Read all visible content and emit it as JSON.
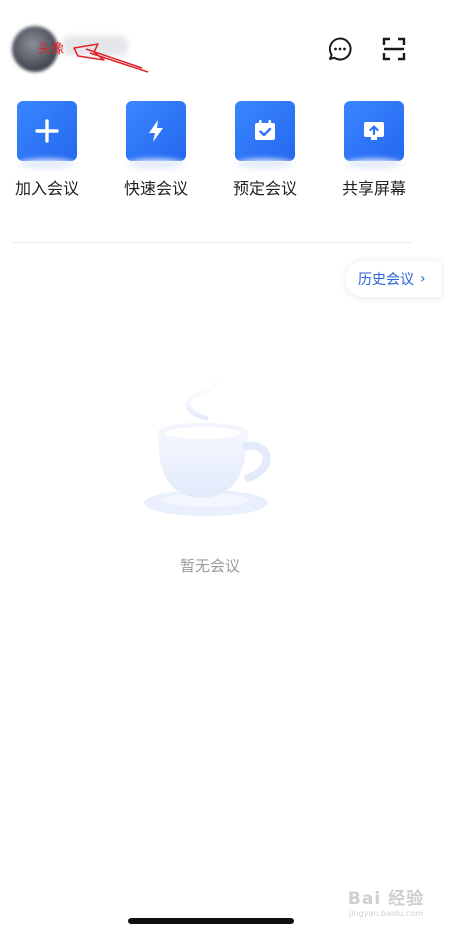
{
  "header": {
    "annotation_label": "头像",
    "icons": [
      "chat-bubble-icon",
      "scan-icon"
    ]
  },
  "actions": [
    {
      "label": "加入会议",
      "icon": "plus-icon"
    },
    {
      "label": "快速会议",
      "icon": "lightning-icon"
    },
    {
      "label": "预定会议",
      "icon": "calendar-check-icon"
    },
    {
      "label": "共享屏幕",
      "icon": "screen-share-icon"
    }
  ],
  "history": {
    "label": "历史会议",
    "chevron": "›"
  },
  "empty_state": {
    "text": "暂无会议",
    "icon": "coffee-cup-icon"
  },
  "watermark": {
    "brand": "Bai 经验",
    "url": "jingyan.baidu.com"
  },
  "colors": {
    "accent": "#2d74f7",
    "history_text": "#2a63d8",
    "annotation": "#e0222a"
  }
}
